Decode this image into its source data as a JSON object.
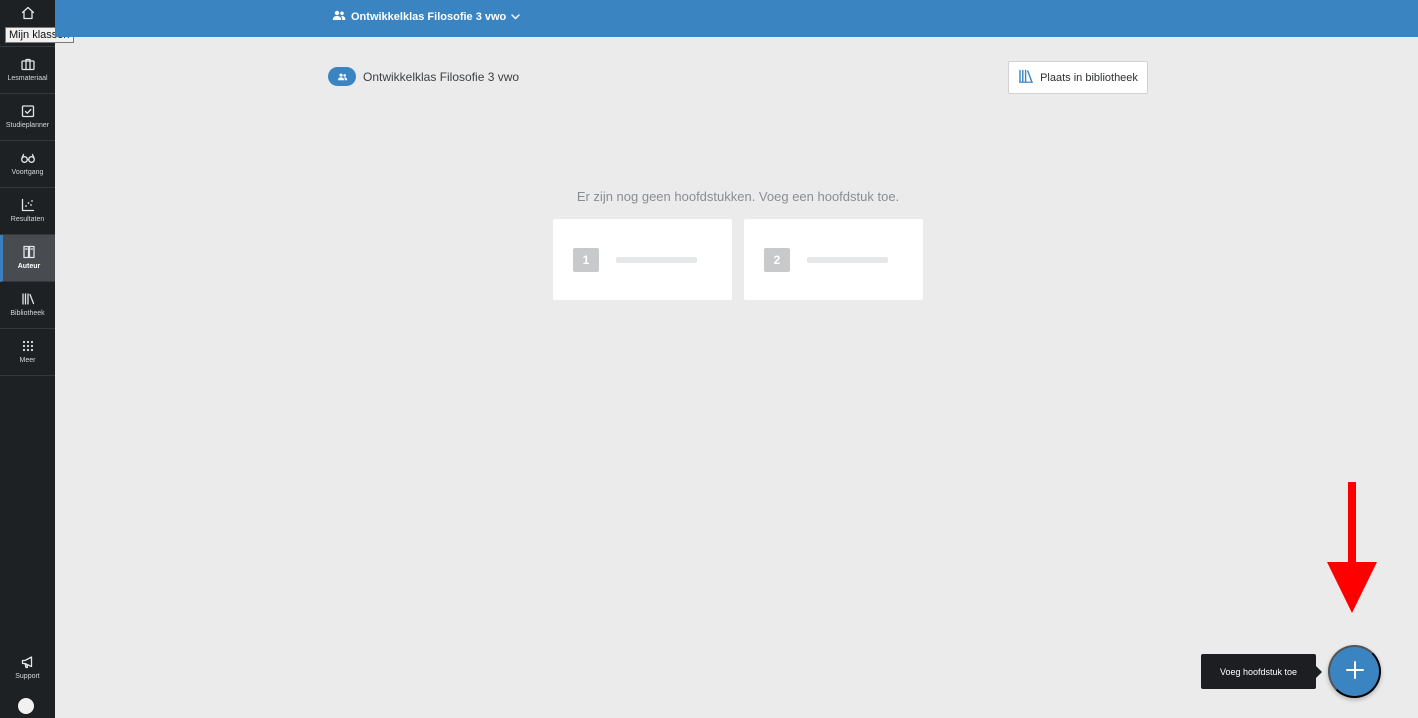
{
  "sidebar": {
    "home_label": "Mijn klassen",
    "tooltip": "Mijn klassen",
    "items": [
      {
        "label": "Lesmateriaal",
        "icon": "briefcase-icon"
      },
      {
        "label": "Studieplanner",
        "icon": "calendar-check-icon"
      },
      {
        "label": "Voortgang",
        "icon": "glasses-icon"
      },
      {
        "label": "Resultaten",
        "icon": "chart-scatter-icon"
      },
      {
        "label": "Auteur",
        "icon": "author-book-icon",
        "active": true
      },
      {
        "label": "Bibliotheek",
        "icon": "library-icon"
      },
      {
        "label": "Meer",
        "icon": "grid-dots-icon"
      }
    ],
    "support_label": "Support"
  },
  "topbar": {
    "class_name": "Ontwikkelklas Filosofie 3 vwo"
  },
  "header": {
    "breadcrumb": "Ontwikkelklas Filosofie 3 vwo",
    "library_button": "Plaats in bibliotheek"
  },
  "main": {
    "empty_message": "Er zijn nog geen hoofdstukken. Voeg een hoofdstuk toe.",
    "placeholders": [
      "1",
      "2"
    ]
  },
  "fab": {
    "tooltip": "Voeg hoofdstuk toe"
  },
  "colors": {
    "accent": "#3a84c2",
    "sidebar": "#1e2124",
    "background": "#ebebeb",
    "annotation": "#ff0000"
  }
}
